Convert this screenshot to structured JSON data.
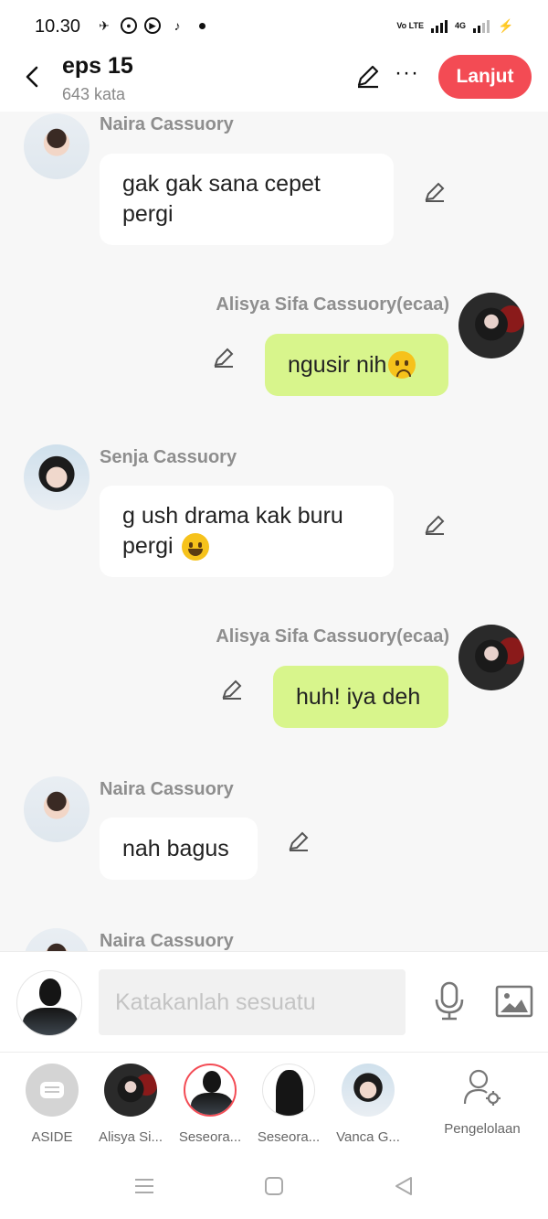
{
  "status_bar": {
    "time": "10.30",
    "network": "4G",
    "volte": "Vo LTE"
  },
  "header": {
    "title": "eps 15",
    "word_count": "643 kata",
    "next_label": "Lanjut",
    "more_label": "···"
  },
  "messages": [
    {
      "sender": "Naira Cassuory",
      "text": "gak gak sana cepet pergi",
      "side": "left",
      "emoji": ""
    },
    {
      "sender": "Alisya Sifa Cassuory(ecaa)",
      "text": "ngusir nih",
      "side": "right",
      "emoji": "sad-crying"
    },
    {
      "sender": "Senja Cassuory",
      "text": "g ush drama kak buru pergi",
      "side": "left",
      "emoji": "grinning"
    },
    {
      "sender": "Alisya Sifa Cassuory(ecaa)",
      "text": "huh! iya deh",
      "side": "right",
      "emoji": ""
    },
    {
      "sender": "Naira Cassuory",
      "text": "nah bagus",
      "side": "left",
      "emoji": ""
    },
    {
      "sender": "Naira Cassuory",
      "text": "",
      "side": "left",
      "emoji": ""
    }
  ],
  "composer": {
    "placeholder": "Katakanlah sesuatu",
    "value": ""
  },
  "roles": [
    {
      "label": "ASIDE"
    },
    {
      "label": "Alisya Si..."
    },
    {
      "label": "Seseora..."
    },
    {
      "label": "Seseora..."
    },
    {
      "label": "Vanca G..."
    },
    {
      "label": "Pengelolaan"
    }
  ],
  "colors": {
    "accent": "#f34b54",
    "bubble_self": "#d8f58c",
    "bubble_other": "#ffffff",
    "background": "#f7f7f7"
  },
  "icons": [
    "back-arrow-icon",
    "pencil-icon",
    "more-icon",
    "microphone-icon",
    "image-icon",
    "user-settings-icon",
    "menu-icon",
    "home-icon",
    "back-triangle-icon"
  ]
}
